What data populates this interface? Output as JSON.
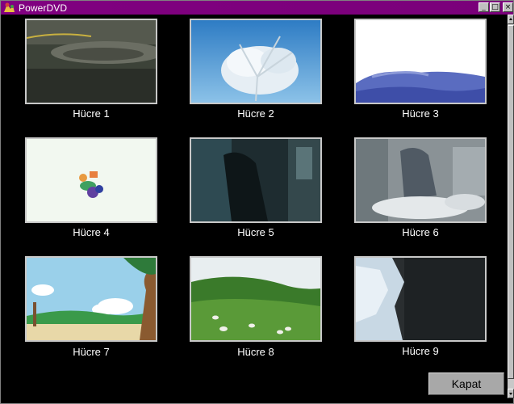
{
  "window": {
    "title": "PowerDVD",
    "min_glyph": "_",
    "max_glyph": "□",
    "close_glyph": "×"
  },
  "cells": [
    {
      "label": "Hücre 1"
    },
    {
      "label": "Hücre 2"
    },
    {
      "label": "Hücre 3"
    },
    {
      "label": "Hücre 4"
    },
    {
      "label": "Hücre 5"
    },
    {
      "label": "Hücre 6"
    },
    {
      "label": "Hücre 7"
    },
    {
      "label": "Hücre 8"
    },
    {
      "label": "Hücre 9"
    }
  ],
  "close_button": {
    "label": "Kapat"
  },
  "colors": {
    "titlebar": "#800080",
    "background": "#000000",
    "thumb_border": "#c8c8c8",
    "button": "#a8a8a8"
  }
}
